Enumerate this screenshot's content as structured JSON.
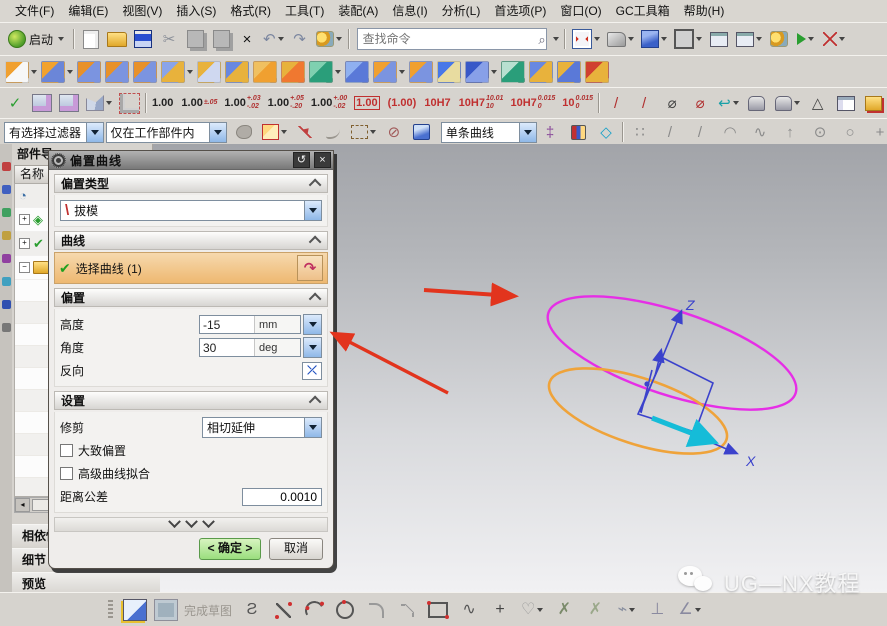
{
  "menu": {
    "items": [
      {
        "label": "文件(F)"
      },
      {
        "label": "编辑(E)"
      },
      {
        "label": "视图(V)"
      },
      {
        "label": "插入(S)"
      },
      {
        "label": "格式(R)"
      },
      {
        "label": "工具(T)"
      },
      {
        "label": "装配(A)"
      },
      {
        "label": "信息(I)"
      },
      {
        "label": "分析(L)"
      },
      {
        "label": "首选项(P)"
      },
      {
        "label": "窗口(O)"
      },
      {
        "label": "GC工具箱"
      },
      {
        "label": "帮助(H)"
      }
    ]
  },
  "toolbar_main": {
    "start_label": "启动",
    "search_placeholder": "查找命令",
    "left_icons": [
      {
        "name": "new-file-icon",
        "cls": "ic-page"
      },
      {
        "name": "open-file-icon",
        "cls": "ic-folder"
      },
      {
        "name": "save-icon",
        "cls": "ic-floppy"
      },
      {
        "name": "cut-icon",
        "glyph": "✂",
        "color": "#8a8f98"
      },
      {
        "name": "copy-icon",
        "cls": "ic-copy"
      },
      {
        "name": "paste-icon",
        "cls": "ic-paste"
      },
      {
        "name": "delete-icon",
        "glyph": "×",
        "color": "#33333"
      },
      {
        "name": "undo-icon",
        "glyph": "↶",
        "color": "#7c87a0",
        "dd": true
      },
      {
        "name": "redo-icon",
        "glyph": "↷",
        "color": "#7c87a0"
      },
      {
        "name": "user-roles-icon",
        "cls": "ic-roles",
        "dd": true
      }
    ],
    "right_icons": [
      {
        "name": "fit-view-icon",
        "cls": "ic-fit",
        "dd": true
      },
      {
        "name": "shaded-view-icon",
        "cls": "ic-shade",
        "dd": true
      },
      {
        "name": "orient-view-icon",
        "cls": "ic-cube",
        "dd": true
      },
      {
        "name": "rendering-style-icon",
        "cls": "ic-square",
        "dd": true
      },
      {
        "name": "window-icon",
        "cls": "ic-win1"
      },
      {
        "name": "new-window-icon",
        "cls": "ic-win2",
        "dd": true
      },
      {
        "name": "role-key-icon",
        "cls": "ic-roles"
      },
      {
        "name": "play-icon",
        "cls": "ic-play",
        "dd": true
      },
      {
        "name": "measure-spark-icon",
        "cls": "ic-spark",
        "dd": true
      }
    ]
  },
  "toolbar_mold": {
    "tiles": [
      {
        "name": "new-sheet-icon",
        "c1": "#f7f7f7",
        "c2": "#f0a030",
        "dd": true
      },
      {
        "name": "mold-wizard-icon",
        "c1": "#6b86d8",
        "c2": "#f2a22e",
        "dd": true
      },
      {
        "name": "cavity-block-icon",
        "c1": "#7b94e0",
        "c2": "#e8912a"
      },
      {
        "name": "core-block-icon",
        "c1": "#7b94e0",
        "c2": "#e8912a"
      },
      {
        "name": "workpiece-icon",
        "c1": "#7b94e0",
        "c2": "#e8912a"
      },
      {
        "name": "check-regions-icon",
        "c1": "#e8b23c",
        "c2": "#8aa4e8",
        "dd": true
      },
      {
        "name": "extract-region-icon",
        "c1": "#cfd8f0",
        "c2": "#e8b23c"
      },
      {
        "name": "define-regions-icon",
        "c1": "#e8b23c",
        "c2": "#6888e0"
      },
      {
        "name": "spot-group-icon",
        "c1": "#f0a030",
        "c2": "#f0c060"
      },
      {
        "name": "parting-surface-icon",
        "c1": "#f07830",
        "c2": "#e8b23c"
      },
      {
        "name": "parting-object-icon",
        "c1": "#2a9e7a",
        "c2": "#7fd0b0",
        "dd": true
      },
      {
        "name": "parting-lines-icon",
        "c1": "#5a79d8",
        "c2": "#8fb0f0"
      },
      {
        "name": "trim-mold-icon",
        "c1": "#7b94e0",
        "c2": "#f0a030",
        "dd": true
      },
      {
        "name": "cavity-layout-icon",
        "c1": "#7b94e0",
        "c2": "#f0a030"
      },
      {
        "name": "swoosh-tool-icon",
        "c1": "#e8dca0",
        "c2": "#4878e8"
      },
      {
        "name": "mold-cubes-icon",
        "c1": "#88a0e8",
        "c2": "#3858c8",
        "dd": true
      },
      {
        "name": "teal-box-icon",
        "c1": "#2a9e7a",
        "c2": "#b8e0d0"
      },
      {
        "name": "gold-boxes-icon",
        "c1": "#e8b23c",
        "c2": "#6888e0"
      },
      {
        "name": "blue-pair-icon",
        "c1": "#5a79d8",
        "c2": "#e8b23c"
      },
      {
        "name": "red-marked-box-icon",
        "c1": "#e8b23c",
        "c2": "#d04030"
      }
    ]
  },
  "toolbar_dim": {
    "left_icons": [
      {
        "name": "finish-check-icon",
        "glyph": "✓",
        "color": "#2a9e30"
      },
      {
        "name": "pattern-grid-icon",
        "cls": "ic-grid1"
      },
      {
        "name": "pattern-grid2-icon",
        "cls": "ic-grid2"
      },
      {
        "name": "unfold-view-icon",
        "cls": "ic-unfold",
        "dd": true
      },
      {
        "name": "corner-section-icon",
        "cls": "ic-corner"
      }
    ],
    "tolerances": [
      {
        "name": "dim-plain",
        "main": "1.00"
      },
      {
        "name": "dim-sym",
        "main": "1.00",
        "top": "±.05"
      },
      {
        "name": "dim-bilateral",
        "main": "1.00",
        "top": "+.03",
        "bot": "-.02"
      },
      {
        "name": "dim-upper",
        "main": "1.00",
        "top": "+.05",
        "bot": "-.20"
      },
      {
        "name": "dim-lower",
        "main": "1.00",
        "top": "+.00",
        "bot": "-.02"
      },
      {
        "name": "dim-boxed",
        "main": "1.00",
        "boxed": true,
        "color": "#c03030"
      },
      {
        "name": "dim-reference",
        "main": "(1.00)",
        "color": "#c03030"
      },
      {
        "name": "dim-fit",
        "main": "10H7",
        "color": "#c03030"
      },
      {
        "name": "dim-fit-limits",
        "main": "10H7",
        "top": "10.01",
        "bot": "10",
        "color": "#c03030"
      },
      {
        "name": "dim-fit-tol",
        "main": "10H7",
        "top": "0.015",
        "bot": "0",
        "color": "#c03030"
      },
      {
        "name": "dim-fit-cut",
        "main": "10",
        "top": "0.015",
        "bot": "0",
        "color": "#c03030"
      }
    ],
    "right_icons": [
      {
        "name": "slash-dim-icon",
        "glyph": "/",
        "color": "#b03030"
      },
      {
        "name": "slash-dim2-icon",
        "glyph": "/",
        "color": "#b03030"
      },
      {
        "name": "diameter-icon",
        "glyph": "⌀",
        "color": "#444"
      },
      {
        "name": "diameter-red-icon",
        "glyph": "⌀",
        "color": "#b03030"
      },
      {
        "name": "return-arrow-icon",
        "glyph": "↩",
        "color": "#18a0a8",
        "dd": true
      },
      {
        "name": "stamp-icon",
        "cls": "ic-stamp"
      },
      {
        "name": "stamp2-icon",
        "cls": "ic-stamp",
        "dd": true
      },
      {
        "name": "triangle-icon",
        "glyph": "△",
        "color": "#444"
      },
      {
        "name": "tolerance-table-icon",
        "cls": "ic-table"
      },
      {
        "name": "annotation-plus-icon",
        "cls": "ic-goldplus"
      },
      {
        "name": "folder-gear-icon",
        "cls": "ic-foldergear"
      },
      {
        "name": "note-box-icon",
        "cls": "ic-notebox"
      }
    ]
  },
  "selection_bar": {
    "filter_value": "有选择过滤器",
    "scope_value": "仅在工作部件内",
    "curve_rule_value": "单条曲线",
    "mid_icons": [
      {
        "name": "select-hand-icon",
        "cls": "ic-blob"
      },
      {
        "name": "highlight-box-icon",
        "cls": "ic-redbox",
        "dd": true
      },
      {
        "name": "add-curve-icon",
        "cls": "ic-plusarrow"
      },
      {
        "name": "curve-grey-icon",
        "cls": "ic-curve"
      },
      {
        "name": "lasso-icon",
        "cls": "ic-dashrect",
        "dd": true
      },
      {
        "name": "no-selection-icon",
        "glyph": "⊘",
        "color": "#a05858"
      },
      {
        "name": "solid-cube-icon",
        "cls": "ic-bluecube"
      }
    ],
    "after_icons": [
      {
        "name": "intersect-stop-icon",
        "glyph": "‡",
        "color": "#8a4a9a"
      },
      {
        "name": "magnet-icon",
        "cls": "ic-magnet"
      },
      {
        "name": "diamond-icon",
        "glyph": "◇",
        "color": "#18a0c8"
      }
    ],
    "snap_icons": [
      {
        "name": "snap-scatter-icon",
        "glyph": "∷",
        "color": "#8a8a8a"
      },
      {
        "name": "snap-endpoint-icon",
        "glyph": "/",
        "color": "#8a8a8a"
      },
      {
        "name": "snap-midpoint-icon",
        "glyph": "/",
        "color": "#8a8a8a"
      },
      {
        "name": "snap-arc-icon",
        "glyph": "◠",
        "color": "#8a8a8a"
      },
      {
        "name": "snap-spline-icon",
        "glyph": "∿",
        "color": "#8a8a8a"
      },
      {
        "name": "snap-pole-icon",
        "glyph": "↑",
        "color": "#8a8a8a"
      },
      {
        "name": "snap-center-icon",
        "glyph": "⊙",
        "color": "#8a8a8a"
      },
      {
        "name": "snap-quadrant-icon",
        "glyph": "○",
        "color": "#8a8a8a"
      },
      {
        "name": "snap-point-icon",
        "glyph": "+",
        "color": "#8a8a8a"
      }
    ]
  },
  "navigator": {
    "tab_title": "部件导",
    "name_column": "名称",
    "tree_items": [
      {
        "name": "history-node",
        "glyph": "◔",
        "color": "#3a6ea5",
        "exp": ""
      },
      {
        "name": "model-views-node",
        "glyph": "◈",
        "color": "#2a9e30",
        "exp": "+"
      },
      {
        "name": "cameras-node",
        "glyph": "✔",
        "color": "#2a9e30",
        "exp": "+"
      },
      {
        "name": "model-history-node",
        "cls": "ic-folder-sm",
        "exp": "−"
      }
    ],
    "bottom_panels": [
      {
        "name": "panel-dependencies",
        "label": "相依性"
      },
      {
        "name": "panel-details",
        "label": "细节"
      },
      {
        "name": "panel-preview",
        "label": "预览"
      }
    ]
  },
  "dialog": {
    "title": "偏置曲线",
    "offset_type_label": "偏置类型",
    "offset_type_value": "拔模",
    "type_icon_glyph": "\\",
    "curve_label": "曲线",
    "select_curve_label": "选择曲线 (1)",
    "curve_btn_glyph": "↷",
    "offset_label": "偏置",
    "height_label": "高度",
    "height_value": "-15",
    "height_unit": "mm",
    "angle_label": "角度",
    "angle_value": "30",
    "angle_unit": "deg",
    "reverse_label": "反向",
    "reverse_glyph": "⤫",
    "settings_label": "设置",
    "trim_label": "修剪",
    "trim_value": "相切延伸",
    "approx_offset_label": "大致偏置",
    "advanced_fit_label": "高级曲线拟合",
    "tolerance_label": "距离公差",
    "tolerance_value": "0.0010",
    "reset_glyph": "↺",
    "close_glyph": "×",
    "ok_label": "< 确定 >",
    "cancel_label": "取消"
  },
  "viewport": {
    "z_axis_label": "Z",
    "x_axis_label": "X",
    "colors": {
      "offset_curve": "#e62ee6",
      "source_curve": "#efa33a",
      "wireframe": "#3b42cc",
      "direction_arrow": "#15bcd8",
      "annotation_arrow": "#e2341d"
    }
  },
  "bottom_toolbar": {
    "finish_sketch_label": "完成草图",
    "items_left": [
      {
        "name": "sketch-task-icon",
        "cls": "ic-sketchtask"
      },
      {
        "name": "finish-sketch-icon",
        "cls": "ic-finishsketch"
      }
    ],
    "items": [
      {
        "name": "profile-icon",
        "glyph": "Ƨ",
        "color": "#555"
      },
      {
        "name": "line-icon",
        "cls": "ic-linered"
      },
      {
        "name": "arc-icon",
        "cls": "ic-arcred"
      },
      {
        "name": "circle-icon",
        "cls": "ic-circlered"
      },
      {
        "name": "fillet-icon",
        "cls": "ic-fillet"
      },
      {
        "name": "chamfer-icon",
        "cls": "ic-chamfer"
      },
      {
        "name": "rectangle-icon",
        "cls": "ic-rectred"
      },
      {
        "name": "studio-spline-icon",
        "glyph": "∿",
        "color": "#555"
      },
      {
        "name": "point-icon",
        "glyph": "+",
        "color": "#444"
      },
      {
        "name": "ellipse-tool-icon",
        "glyph": "♡",
        "color": "#999",
        "dd": true
      },
      {
        "name": "quick-trim-icon",
        "glyph": "✗",
        "color": "#7a8a6a"
      },
      {
        "name": "quick-extend-icon",
        "glyph": "✗",
        "color": "#9aa88a"
      },
      {
        "name": "make-corner-icon",
        "glyph": "⌁",
        "color": "#8a90a0",
        "dd": true
      },
      {
        "name": "constraints-icon",
        "glyph": "⊥",
        "color": "#8a8aa0"
      },
      {
        "name": "auto-dimension-icon",
        "glyph": "∠",
        "color": "#8a8aa0",
        "dd": true
      }
    ]
  },
  "watermark": {
    "text": "UG—NX教程"
  }
}
